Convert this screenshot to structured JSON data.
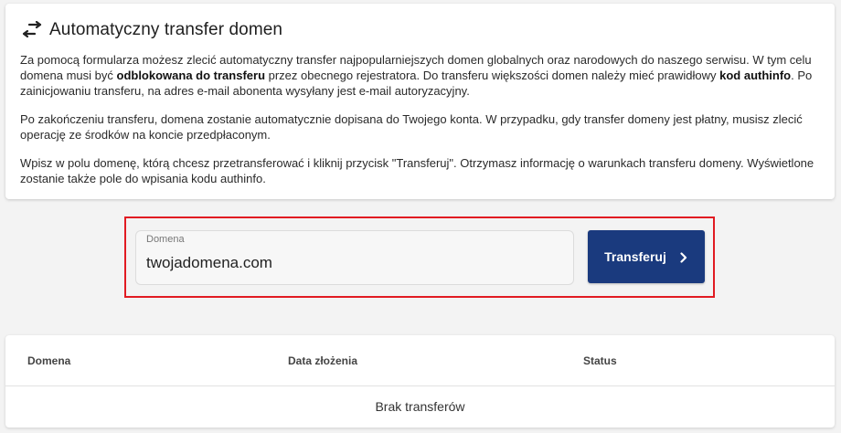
{
  "header": {
    "icon": "transfer-arrows-icon",
    "title": "Automatyczny transfer domen"
  },
  "description": {
    "p1_a": "Za pomocą formularza możesz zlecić automatyczny transfer najpopularniejszych domen globalnych oraz narodowych do naszego serwisu. W tym celu domena musi być ",
    "p1_b": "odblokowana do transferu",
    "p1_c": " przez obecnego rejestratora. Do transferu większości domen należy mieć prawidłowy ",
    "p1_d": "kod authinfo",
    "p1_e": ". Po zainicjowaniu transferu, na adres e-mail abonenta wysyłany jest e-mail autoryzacyjny.",
    "p2": "Po zakończeniu transferu, domena zostanie automatycznie dopisana do Twojego konta. W przypadku, gdy transfer domeny jest płatny, musisz zlecić operację ze środków na koncie przedpłaconym.",
    "p3": "Wpisz w polu domenę, którą chcesz przetransferować i kliknij przycisk \"Transferuj\". Otrzymasz informację o warunkach transferu domeny. Wyświetlone zostanie także pole do wpisania kodu authinfo."
  },
  "form": {
    "domain_label": "Domena",
    "domain_value": "twojadomena.com",
    "submit_label": "Transferuj",
    "submit_icon": "chevron-right-icon"
  },
  "table": {
    "columns": [
      "Domena",
      "Data złożenia",
      "Status"
    ],
    "empty_message": "Brak transferów"
  },
  "colors": {
    "accent": "#1a3a7e",
    "highlight_frame": "#e11b22",
    "background": "#f3f3f3"
  }
}
